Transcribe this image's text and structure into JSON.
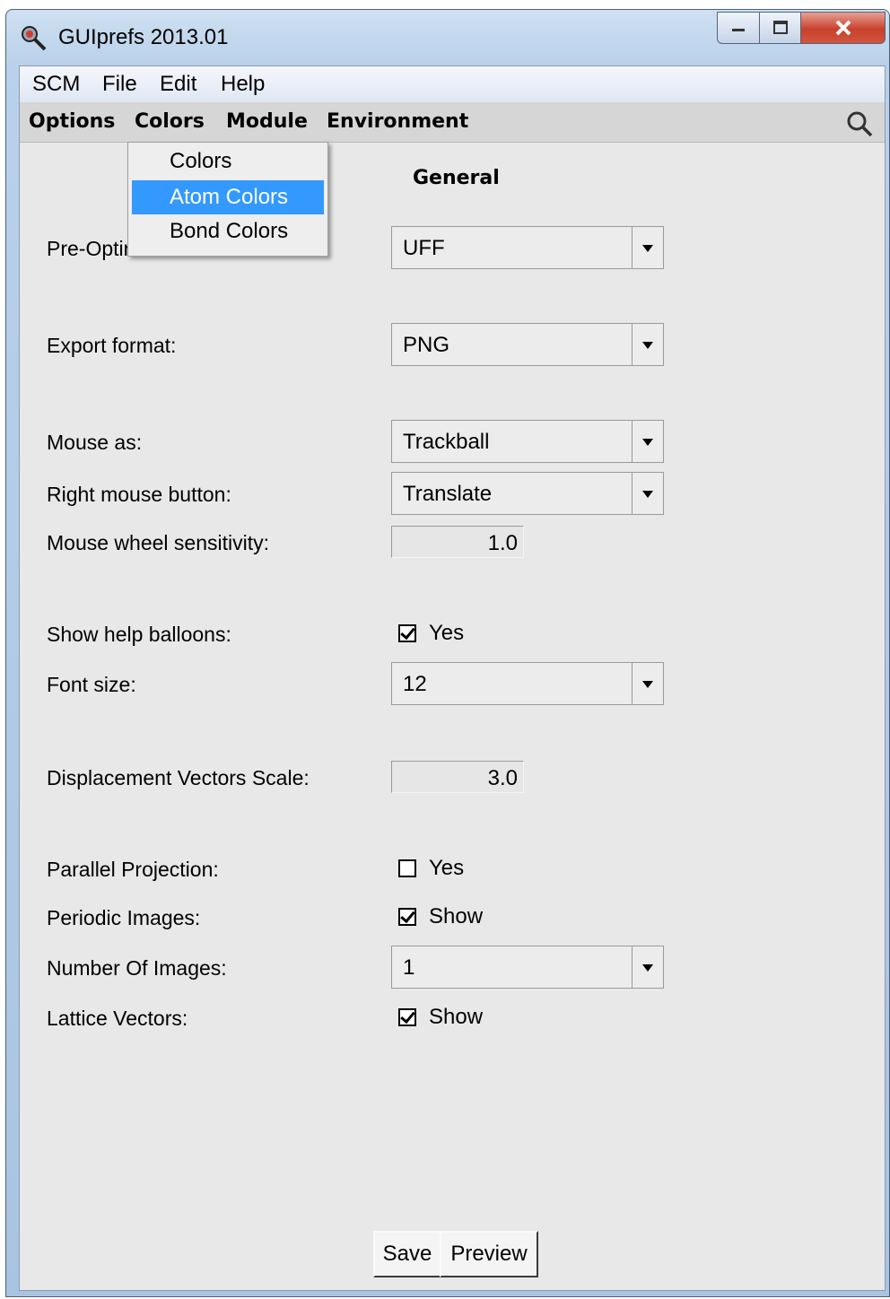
{
  "window": {
    "title": "GUIprefs 2013.01"
  },
  "menubar": {
    "items": [
      "SCM",
      "File",
      "Edit",
      "Help"
    ]
  },
  "tabs": [
    "Options",
    "Colors",
    "Module",
    "Environment"
  ],
  "dropdown": {
    "items": [
      "Colors",
      "Atom Colors",
      "Bond Colors"
    ],
    "active": "Atom Colors"
  },
  "section": {
    "title": "General"
  },
  "form": {
    "pre_opt_label": "Pre-Optir",
    "pre_opt_value": "UFF",
    "export_label": "Export format:",
    "export_value": "PNG",
    "mouse_as_label": "Mouse as:",
    "mouse_as_value": "Trackball",
    "right_mouse_label": "Right mouse button:",
    "right_mouse_value": "Translate",
    "wheel_label": "Mouse wheel sensitivity:",
    "wheel_value": "1.0",
    "balloons_label": "Show help balloons:",
    "balloons_text": "Yes",
    "balloons_checked": true,
    "font_label": "Font size:",
    "font_value": "12",
    "disp_label": "Displacement Vectors Scale:",
    "disp_value": "3.0",
    "parallel_label": "Parallel Projection:",
    "parallel_text": "Yes",
    "parallel_checked": false,
    "periodic_label": "Periodic Images:",
    "periodic_text": "Show",
    "periodic_checked": true,
    "num_images_label": "Number Of Images:",
    "num_images_value": "1",
    "lattice_label": "Lattice Vectors:",
    "lattice_text": "Show",
    "lattice_checked": true
  },
  "buttons": {
    "save": "Save",
    "preview": "Preview"
  },
  "colors": {
    "selection": "#3399ff",
    "client_bg": "#e8e8e8",
    "close_red": "#c7412c"
  }
}
